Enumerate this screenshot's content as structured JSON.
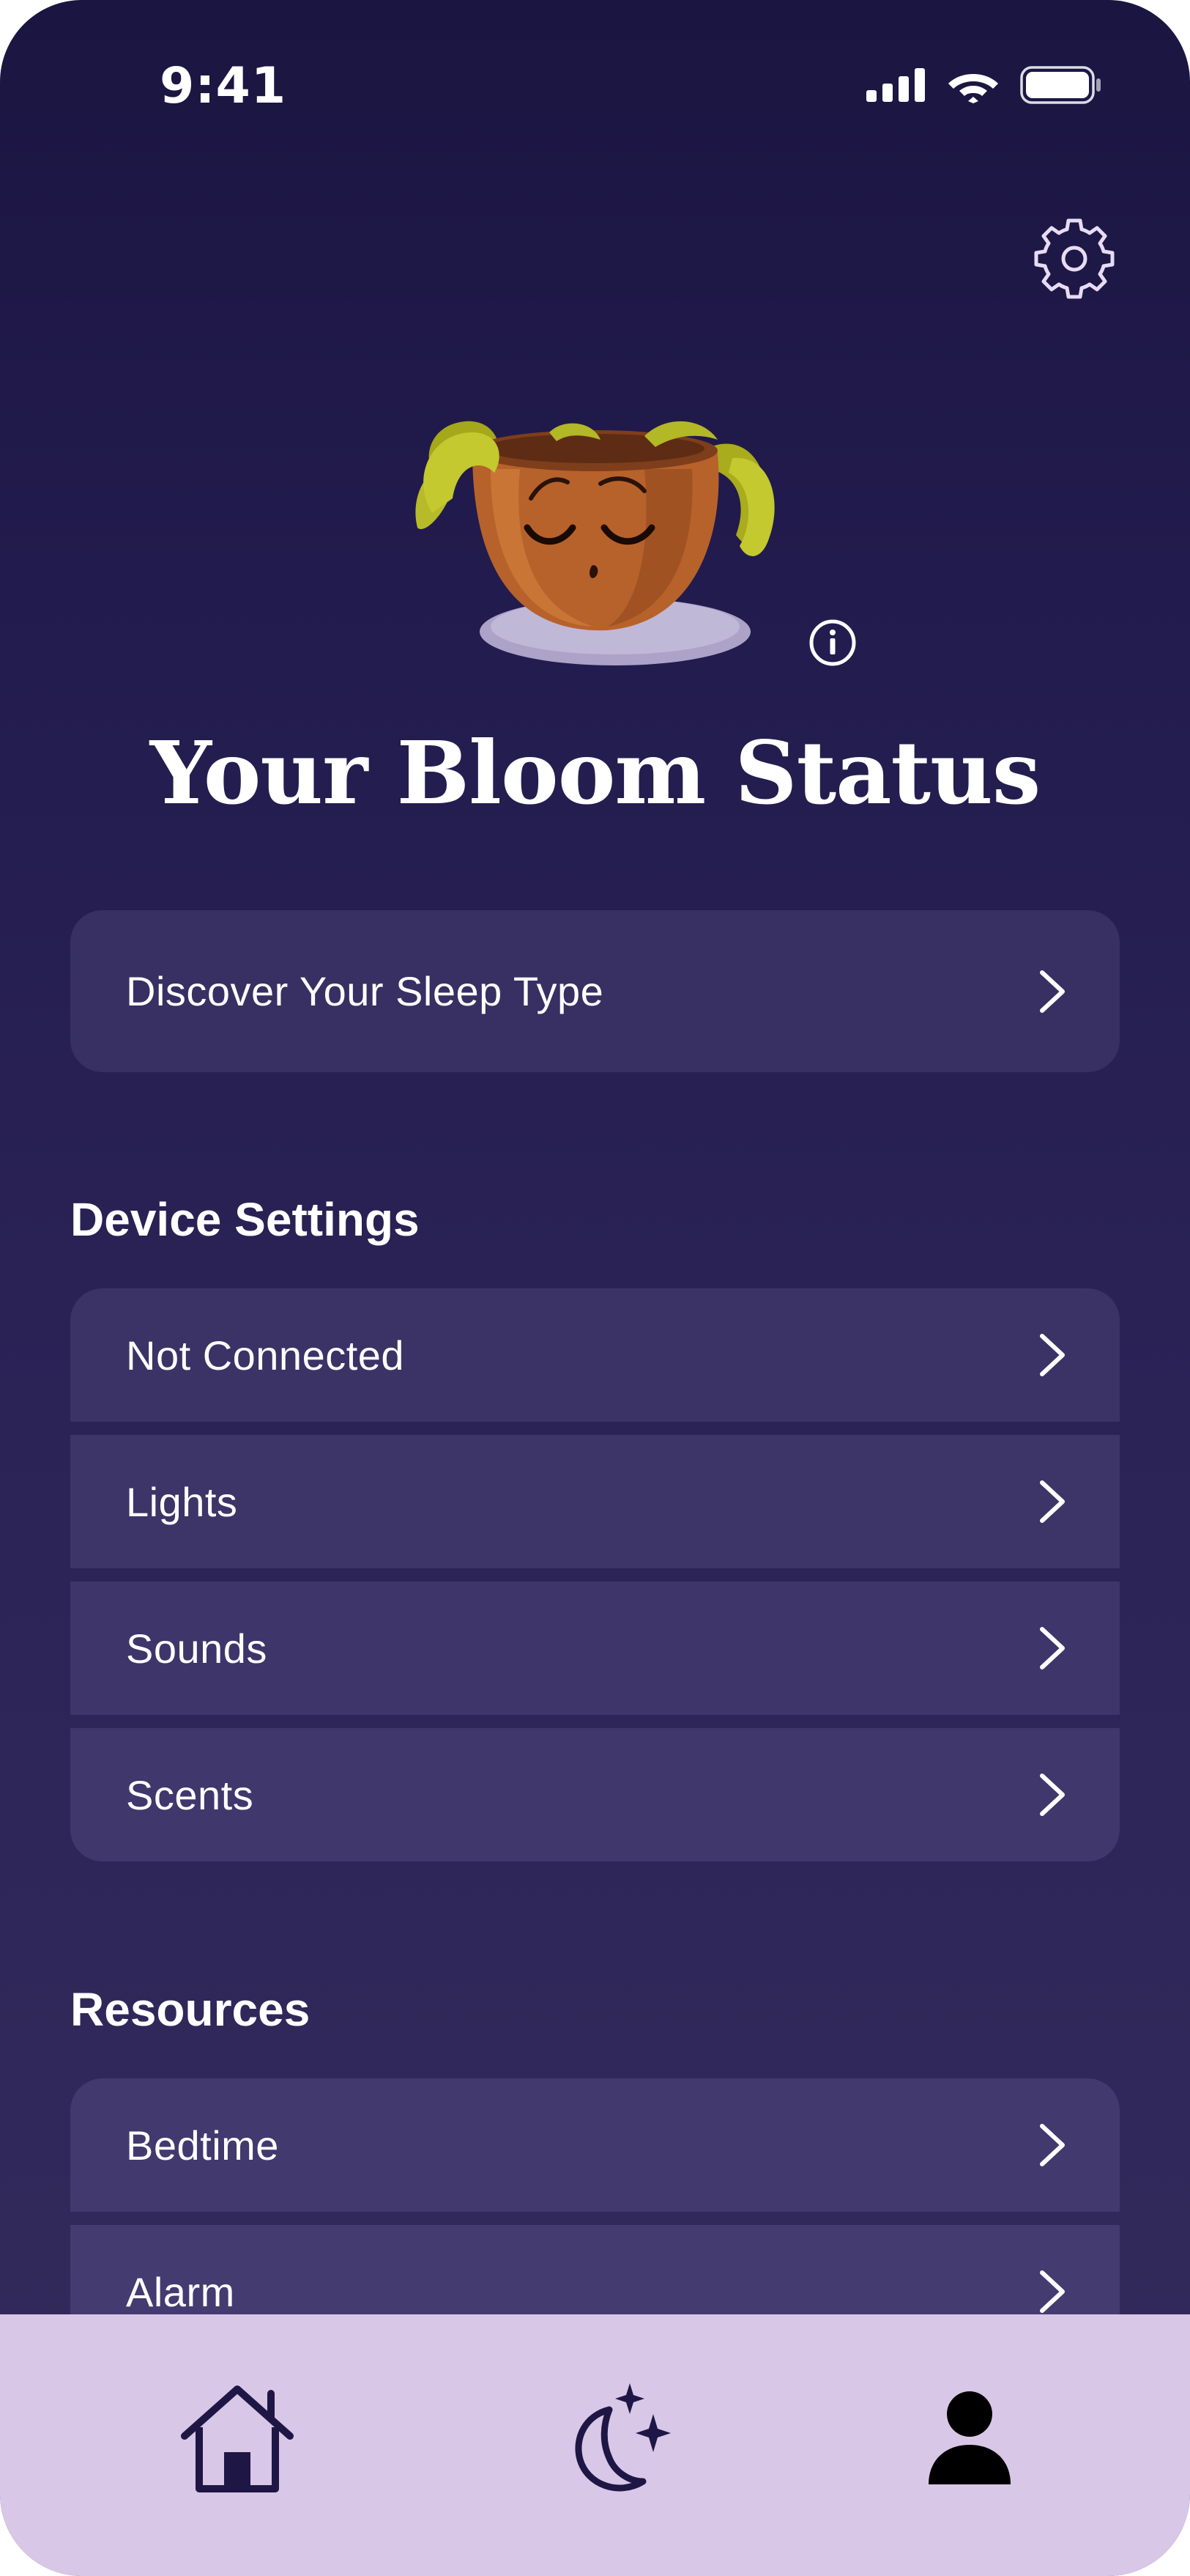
{
  "status_bar": {
    "time": "9:41"
  },
  "header": {
    "settings_icon": "gear-icon"
  },
  "hero": {
    "mascot_icon": "sleeping-plant-pot",
    "info_icon": "info-icon",
    "title": "Your Bloom Status"
  },
  "primary_card": {
    "label": "Discover Your Sleep Type"
  },
  "device_settings": {
    "heading": "Device Settings",
    "items": [
      {
        "label": "Not Connected"
      },
      {
        "label": "Lights"
      },
      {
        "label": "Sounds"
      },
      {
        "label": "Scents"
      }
    ]
  },
  "resources": {
    "heading": "Resources",
    "items": [
      {
        "label": "Bedtime"
      },
      {
        "label": "Alarm"
      }
    ]
  },
  "bottom_nav": {
    "items": [
      {
        "icon": "home-icon"
      },
      {
        "icon": "moon-stars-icon"
      },
      {
        "icon": "profile-icon"
      }
    ]
  },
  "colors": {
    "background_top": "#1b1541",
    "background_bottom": "#332b5c",
    "card": "#3d3468",
    "nav_bar": "#d9c7e7",
    "nav_icon": "#1e1745"
  }
}
